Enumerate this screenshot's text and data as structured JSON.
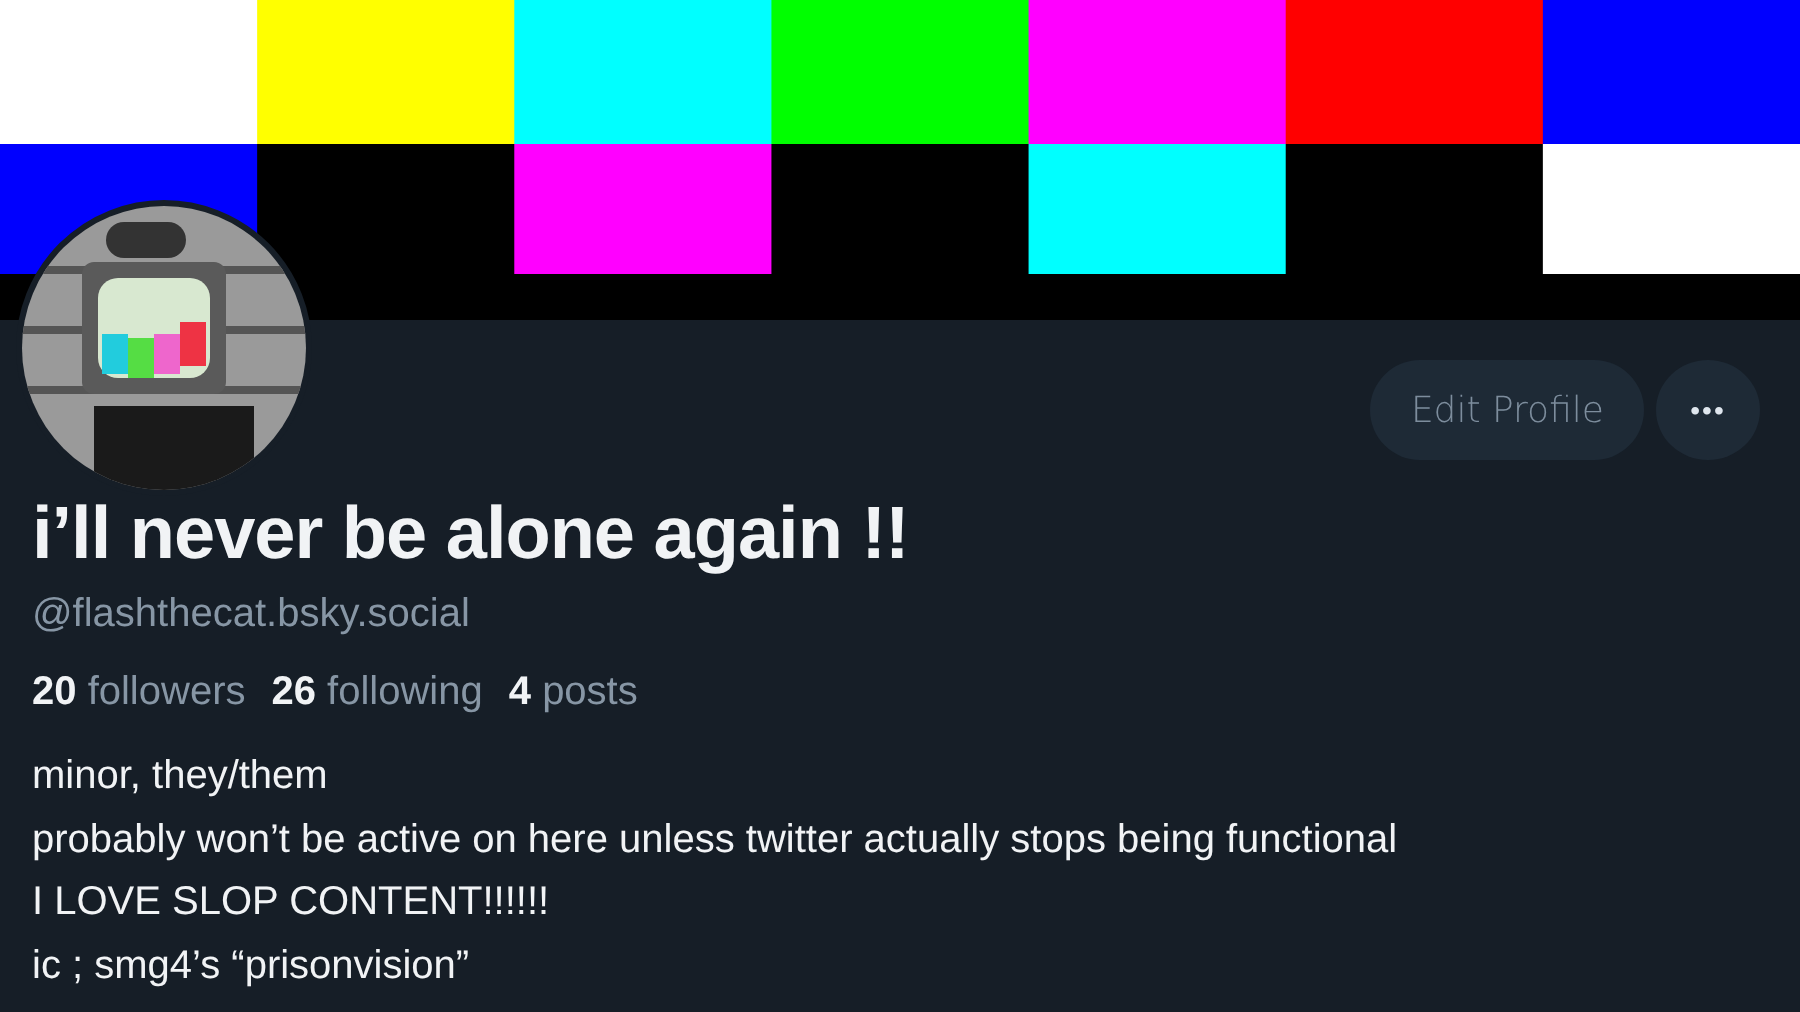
{
  "actions": {
    "edit_button": "Edit Profile",
    "more_button": "•••"
  },
  "profile": {
    "display_name": "i’ll never be alone again !!",
    "handle": "@flashthecat.bsky.social"
  },
  "stats": [
    {
      "count": "20",
      "label": "followers"
    },
    {
      "count": "26",
      "label": "following"
    },
    {
      "count": "4",
      "label": "posts"
    }
  ],
  "bio": [
    "minor, they/them",
    "probably won’t be active on here unless twitter actually stops being functional",
    "I LOVE SLOP CONTENT!!!!!!",
    "ic ; smg4’s “prisonvision”"
  ]
}
